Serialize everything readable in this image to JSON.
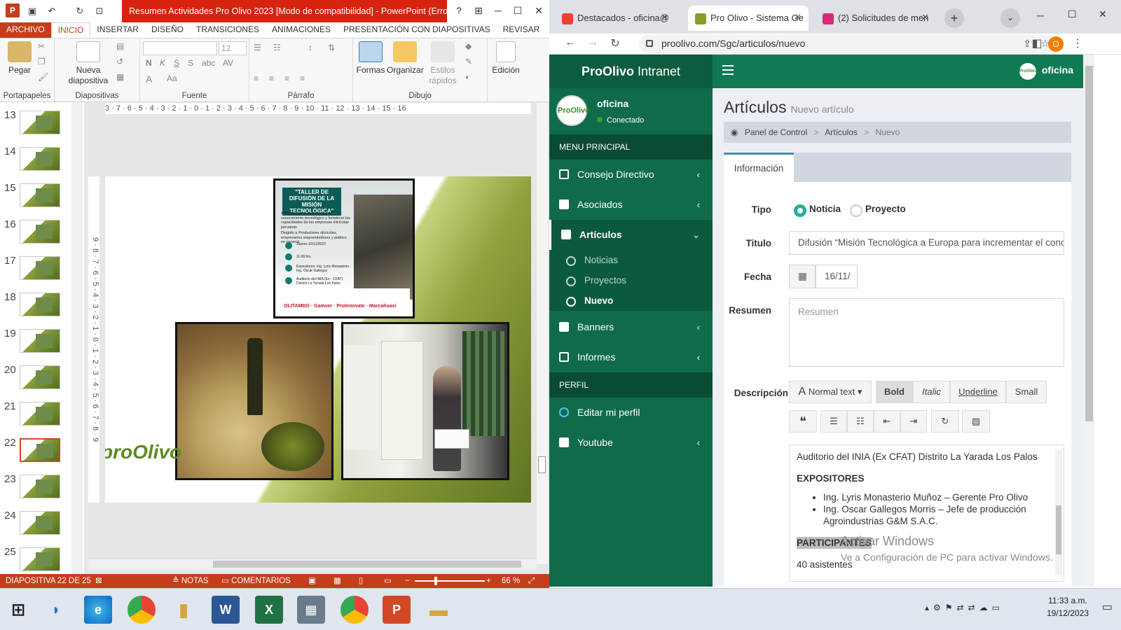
{
  "ppt": {
    "doc_title": "Resumen Actividades Pro Olivo 2023 [Modo de compatibilidad] - PowerPoint (Error...",
    "qat": {
      "help": "?",
      "restore_icon": "ribbon-display-icon",
      "min": "─",
      "max": "☐",
      "close": "✕"
    },
    "tabs": [
      "ARCHIVO",
      "INICIO",
      "INSERTAR",
      "DISEÑO",
      "TRANSICIONES",
      "ANIMACIONES",
      "PRESENTACIÓN CON DIAPOSITIVAS",
      "REVISAR"
    ],
    "groups": {
      "portapapeles": "Portapapeles",
      "diapositivas": "Diapositivas",
      "fuente": "Fuente",
      "parrafo": "Párrafo",
      "dibujo": "Dibujo"
    },
    "buttons": {
      "pegar": "Pegar",
      "nueva": "Nueva",
      "diapositiva": "diapositiva",
      "formas": "Formas",
      "organizar": "Organizar",
      "estilos": "Estilos",
      "rapidos": "rápidos",
      "edicion": "Edición",
      "font_size": "12"
    },
    "ruler_top": "3 · 7 · 6 · 5 · 4 · 3 · 2 · 1 · 0 · 1 · 2 · 3 · 4 · 5 · 6 · 7 · 8 · 9 · 10 · 11 · 12 · 13 · 14 · 15 · 16",
    "ruler_left": "9 · 8 · 7 · 6 · 5 · 4 · 3 · 2 · 1 · 0 · 1 · 2 · 3 · 4 · 5 · 6 · 7 · 8 · 9",
    "thumbs": [
      "13",
      "14",
      "15",
      "16",
      "17",
      "18",
      "19",
      "20",
      "21",
      "22",
      "23",
      "24",
      "25"
    ],
    "selected_thumb": "22",
    "slide": {
      "poster_title": "\"TALLER DE DIFUSIÓN DE LA MISIÓN TECNOLÓGICA\"",
      "poster_sub": "A Europa para incrementar el conocimiento tecnológico y fortalecer las capacidades de las empresas olivícolas peruanas",
      "poster_dir": "Dirigido a Productores olivícolas, empresarios emprendedores y público en general",
      "poster_date": "Jueves 16/11/2023",
      "poster_time": "11:00 hrs.",
      "poster_exp": "Expositores: Ing. Lyris Monasterio · Ing. Oscar Gallegos",
      "poster_place": "Auditorio del INIA (Ex - CFAT) Distrito La Yarada Los Palos",
      "poster_logos": "OLITAMBO · Gamver · ProInnovate · Marcahuasi",
      "logo_text": "proOlivo"
    },
    "status": {
      "slide": "DIAPOSITIVA 22 DE 25",
      "notas": "NOTAS",
      "comentarios": "COMENTARIOS",
      "zoom": "66 %"
    }
  },
  "chrome": {
    "tabs": [
      {
        "title": "Destacados - oficina@",
        "icon": "gmail-icon",
        "color": "#ea4335"
      },
      {
        "title": "Pro Olivo - Sistema Ge",
        "icon": "proolivo-icon",
        "color": "#8a9a2a"
      },
      {
        "title": "(2) Solicitudes de men",
        "icon": "instagram-icon",
        "color": "#d62976"
      }
    ],
    "url": "proolivo.com/Sgc/articulos/nuevo",
    "profile_initial": "O"
  },
  "site": {
    "brand_bold": "ProOlivo",
    "brand_light": " Intranet",
    "user": "oficina",
    "status": "Conectado",
    "menu_header": "MENU PRINCIPAL",
    "menu": [
      {
        "label": "Consejo Directivo",
        "chev": "‹"
      },
      {
        "label": "Asociados",
        "chev": "‹"
      },
      {
        "label": "Artículos",
        "chev": "⌄"
      }
    ],
    "sub": [
      "Noticias",
      "Proyectos",
      "Nuevo"
    ],
    "menu2": [
      {
        "label": "Banners",
        "chev": "‹"
      },
      {
        "label": "Informes",
        "chev": "‹"
      }
    ],
    "perfil_header": "PERFIL",
    "perfil": [
      "Editar mi perfil"
    ],
    "youtube": "Youtube",
    "topbar_user": "oficina",
    "avatar_text": "ProOlivo",
    "page_title": "Artículos",
    "page_sub": "Nuevo artículo",
    "breadcrumb": [
      "Panel de Control",
      "Artículos",
      "Nuevo"
    ],
    "tab_info": "Información",
    "form": {
      "tipo": "Tipo",
      "noticia": "Noticia",
      "proyecto": "Proyecto",
      "titulo": "Titulo",
      "titulo_val": "Difusión “Misión Tecnológica a Europa para incrementar el conocimiento",
      "fecha": "Fecha",
      "fecha_val": "16/11/",
      "resumen": "Resumen",
      "resumen_ph": "Resumen",
      "descripcion": "Descripción",
      "toolbar": {
        "normal": "Normal text",
        "bold": "Bold",
        "italic": "Italic",
        "underline": "Underline",
        "small": "Small"
      },
      "editor": {
        "line1": "Auditorio del INIA (Ex CFAT) Distrito La Yarada Los Palos",
        "h1": "EXPOSITORES",
        "li1": "Ing. Lyris Monasterio Muñoz – Gerente Pro Olivo",
        "li2": "Ing. Oscar Gallegos Morris – Jefe de producción Agroindustrias G&M S.A.C.",
        "h2": "PARTICIPANTES",
        "line2": "40 asistentes"
      }
    },
    "activate": "Activar Windows",
    "activate_sub": "Ve a Configuración de PC para activar Windows."
  },
  "taskbar": {
    "time": "11:33 a.m.",
    "date": "19/12/2023",
    "apps": [
      "word",
      "excel",
      "calculator",
      "chrome",
      "powerpoint",
      "explorer"
    ]
  }
}
